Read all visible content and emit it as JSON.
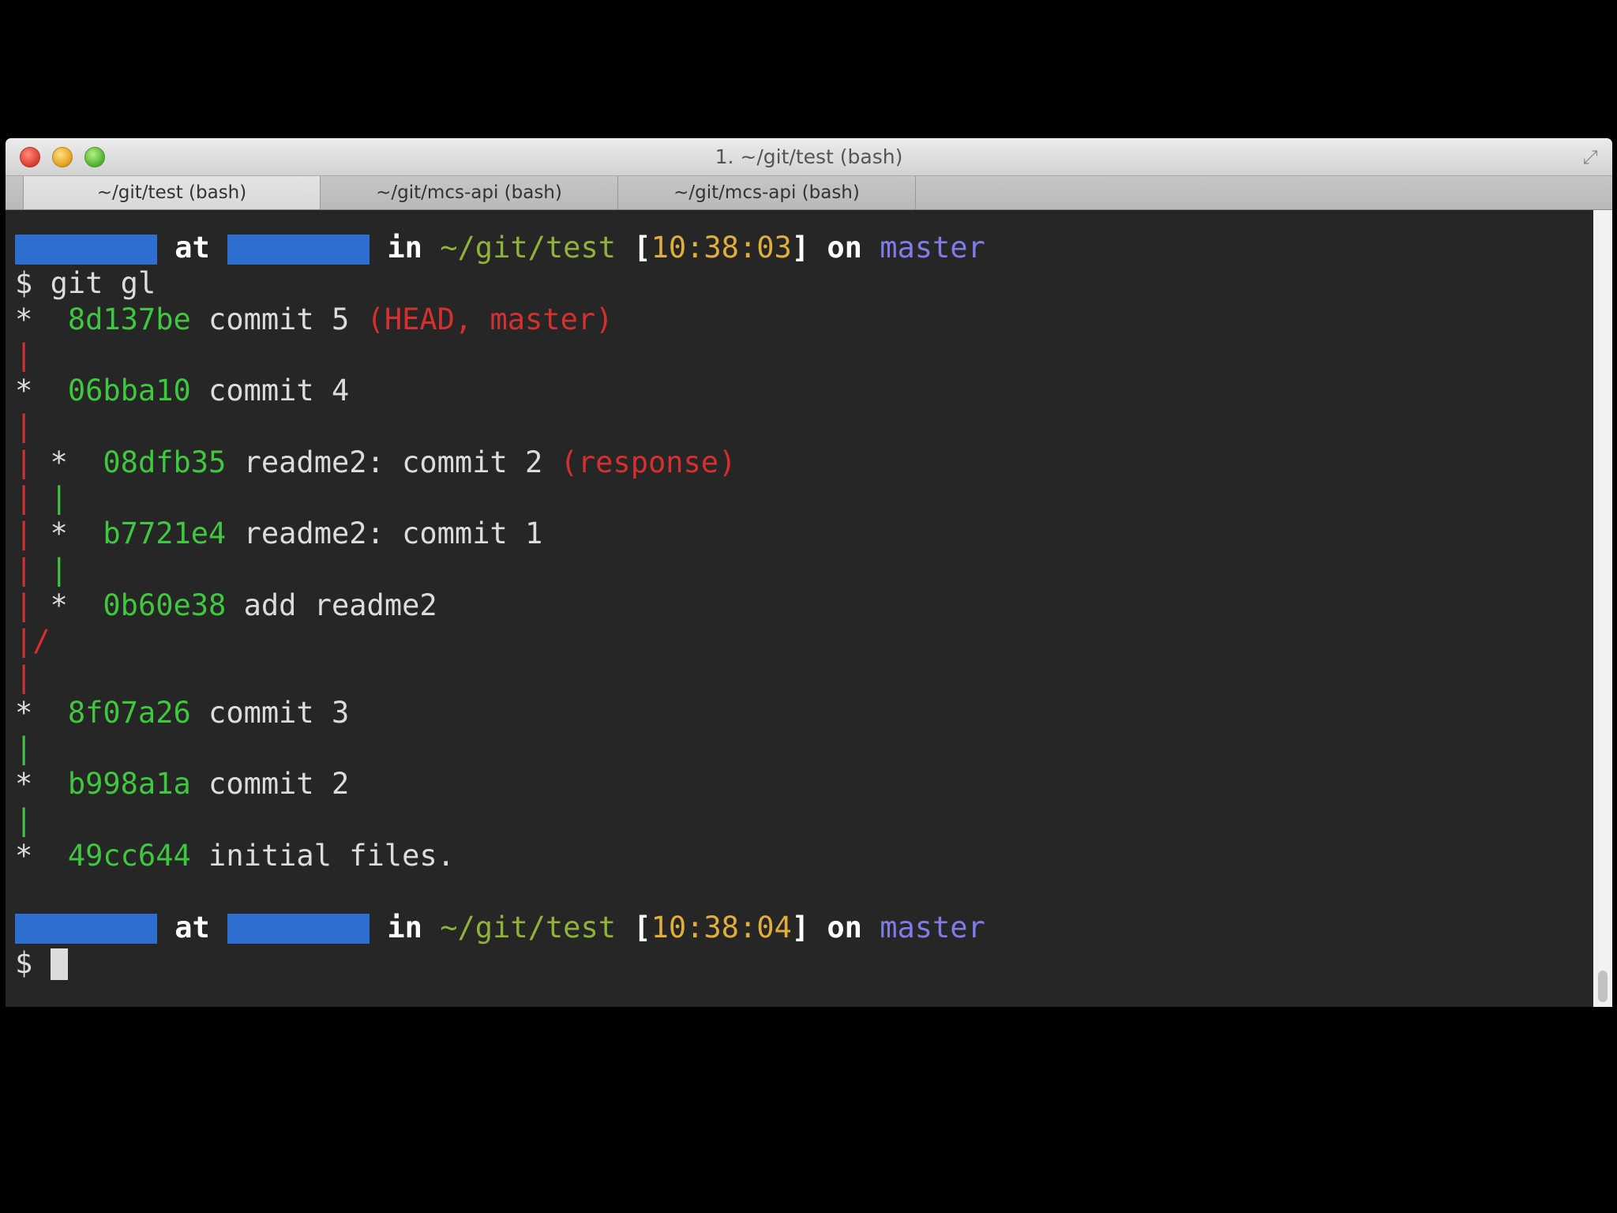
{
  "window": {
    "title": "1. ~/git/test (bash)"
  },
  "tabs": [
    {
      "label": "~/git/test (bash)"
    },
    {
      "label": "~/git/mcs-api (bash)"
    },
    {
      "label": "~/git/mcs-api (bash)"
    }
  ],
  "prompt1": {
    "at": "at",
    "in": "in",
    "path": "~/git/test",
    "open": "[",
    "time": "10:38:03",
    "close": "]",
    "on": "on",
    "branch": "master"
  },
  "command": {
    "symbol": "$",
    "text": "git gl"
  },
  "log": [
    {
      "hash": "8d137be",
      "message": "commit 5",
      "refs": "(HEAD, master)"
    },
    {
      "hash": "06bba10",
      "message": "commit 4"
    },
    {
      "hash": "08dfb35",
      "message": "readme2: commit 2",
      "refs": "(response)"
    },
    {
      "hash": "b7721e4",
      "message": "readme2: commit 1"
    },
    {
      "hash": "0b60e38",
      "message": "add readme2"
    },
    {
      "hash": "8f07a26",
      "message": "commit 3"
    },
    {
      "hash": "b998a1a",
      "message": "commit 2"
    },
    {
      "hash": "49cc644",
      "message": "initial files."
    }
  ],
  "prompt2": {
    "at": "at",
    "in": "in",
    "path": "~/git/test",
    "open": "[",
    "time": "10:38:04",
    "close": "]",
    "on": "on",
    "branch": "master"
  },
  "input": {
    "symbol": "$",
    "value": ""
  },
  "colors": {
    "background": "#262626",
    "hash": "#3fc73f",
    "ref": "#d62f2f",
    "path": "#8fb33a",
    "time": "#e0ae3c",
    "branch": "#7f7be8",
    "redaction": "#2e6ed0"
  }
}
